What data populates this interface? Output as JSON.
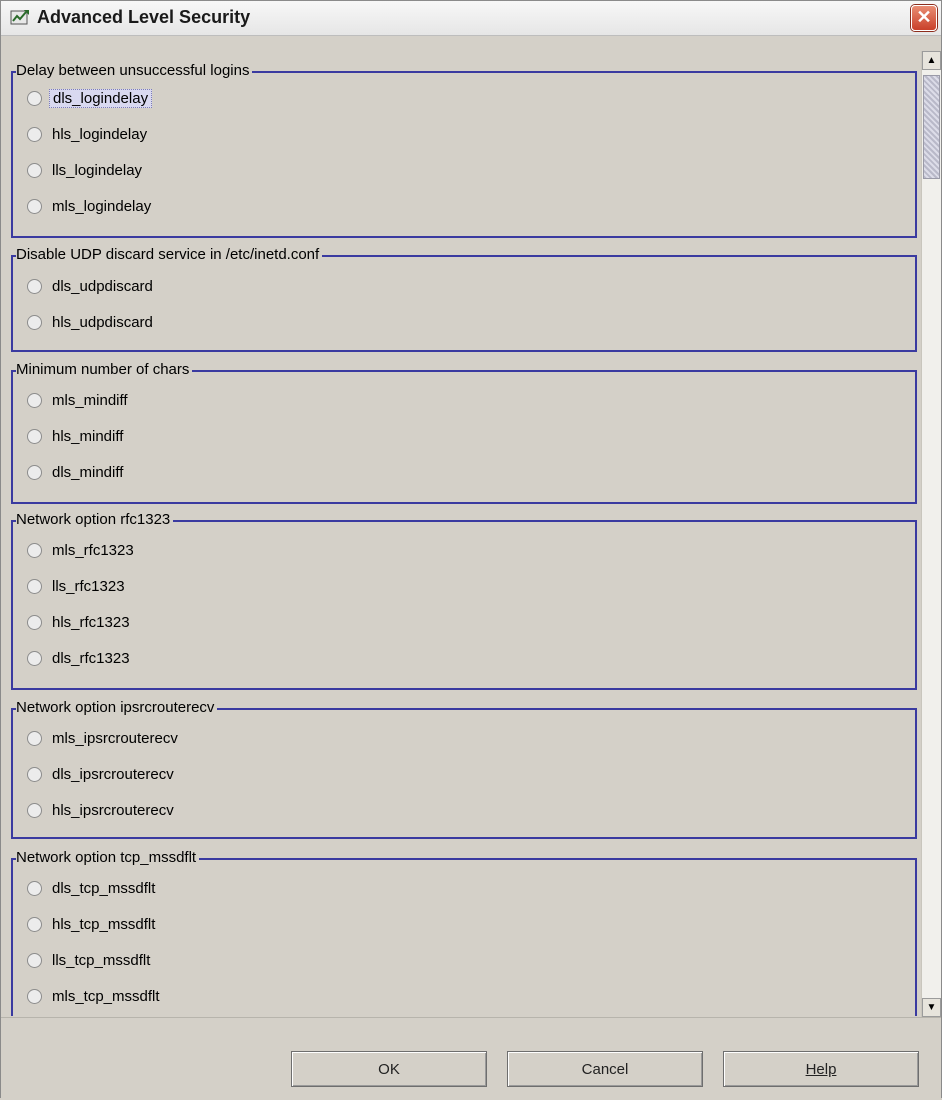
{
  "window": {
    "title": "Advanced Level Security",
    "close_glyph": "✕"
  },
  "groups": [
    {
      "title": "Delay between unsuccessful logins",
      "options": [
        "dls_logindelay",
        "hls_logindelay",
        "lls_logindelay",
        "mls_logindelay"
      ]
    },
    {
      "title": "Disable UDP discard service in /etc/inetd.conf",
      "options": [
        "dls_udpdiscard",
        "hls_udpdiscard"
      ]
    },
    {
      "title": "Minimum number of chars",
      "options": [
        "mls_mindiff",
        "hls_mindiff",
        "dls_mindiff"
      ]
    },
    {
      "title": "Network option rfc1323",
      "options": [
        "mls_rfc1323",
        "lls_rfc1323",
        "hls_rfc1323",
        "dls_rfc1323"
      ]
    },
    {
      "title": "Network option ipsrcrouterecv",
      "options": [
        "mls_ipsrcrouterecv",
        "dls_ipsrcrouterecv",
        "hls_ipsrcrouterecv"
      ]
    },
    {
      "title": "Network option tcp_mssdflt",
      "options": [
        "dls_tcp_mssdflt",
        "hls_tcp_mssdflt",
        "lls_tcp_mssdflt",
        "mls_tcp_mssdflt"
      ]
    }
  ],
  "focused_option": "dls_logindelay",
  "scrollbar": {
    "up_glyph": "▲",
    "down_glyph": "▼"
  },
  "buttons": {
    "ok": "OK",
    "cancel": "Cancel",
    "help": "Help"
  }
}
